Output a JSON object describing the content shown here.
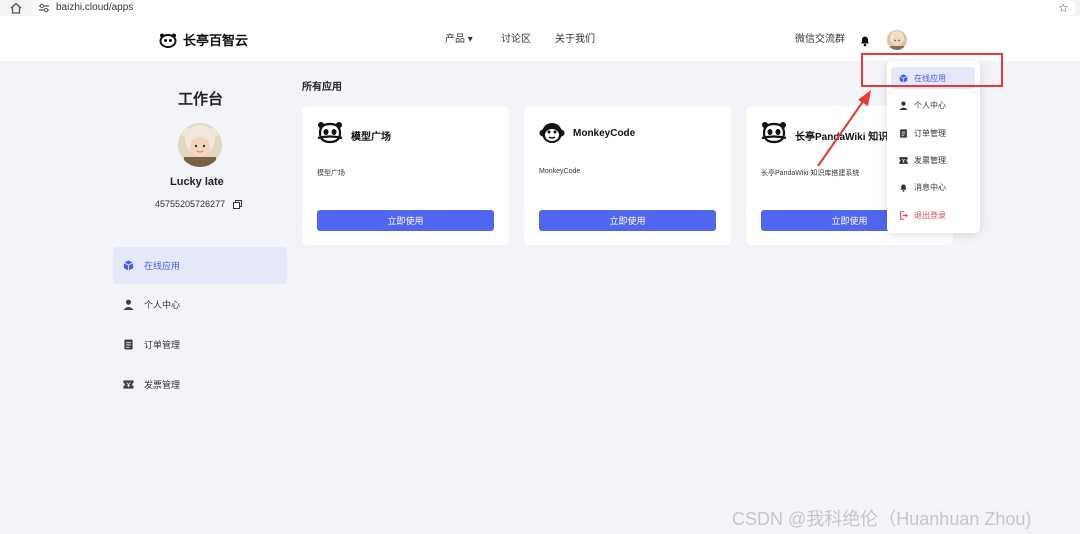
{
  "browser": {
    "url": "baizhi.cloud/apps"
  },
  "brand": {
    "name": "长亭百智云"
  },
  "nav": {
    "product": "产品 ▾",
    "forum": "讨论区",
    "about": "关于我们",
    "wechat_group": "微信交流群"
  },
  "sidebar": {
    "title": "工作台",
    "username": "Lucky late",
    "user_id": "45755205726277",
    "items": [
      {
        "label": "在线应用",
        "icon": "cube-icon",
        "active": true
      },
      {
        "label": "个人中心",
        "icon": "person-icon"
      },
      {
        "label": "订单管理",
        "icon": "document-icon"
      },
      {
        "label": "发票管理",
        "icon": "ticket-icon"
      }
    ]
  },
  "main": {
    "section_title": "所有应用",
    "apps": [
      {
        "name": "模型广场",
        "desc": "模型广场",
        "button": "立即使用",
        "icon": "panda-icon"
      },
      {
        "name": "MonkeyCode",
        "desc": "MonkeyCode",
        "button": "立即使用",
        "icon": "monkey-icon"
      },
      {
        "name": "长亭PandaWiki 知识",
        "desc": "长亭PandaWiki 知识库搭建系统",
        "button": "立即使用",
        "icon": "panda-icon"
      }
    ]
  },
  "dropdown": {
    "items": [
      {
        "label": "在线应用",
        "icon": "cube-icon",
        "active": true
      },
      {
        "label": "个人中心",
        "icon": "person-icon"
      },
      {
        "label": "订单管理",
        "icon": "document-icon"
      },
      {
        "label": "发票管理",
        "icon": "ticket-icon"
      },
      {
        "label": "消息中心",
        "icon": "bell-icon"
      },
      {
        "label": "退出登录",
        "icon": "logout-icon",
        "danger": true
      }
    ]
  },
  "colors": {
    "accent": "#5066ef",
    "active_bg": "#e4e8f8",
    "page_bg": "#f3f4f8",
    "annotation_red": "#e53935",
    "danger": "#e24a4a"
  },
  "watermark": "CSDN @我科绝伦（Huanhuan Zhou)"
}
